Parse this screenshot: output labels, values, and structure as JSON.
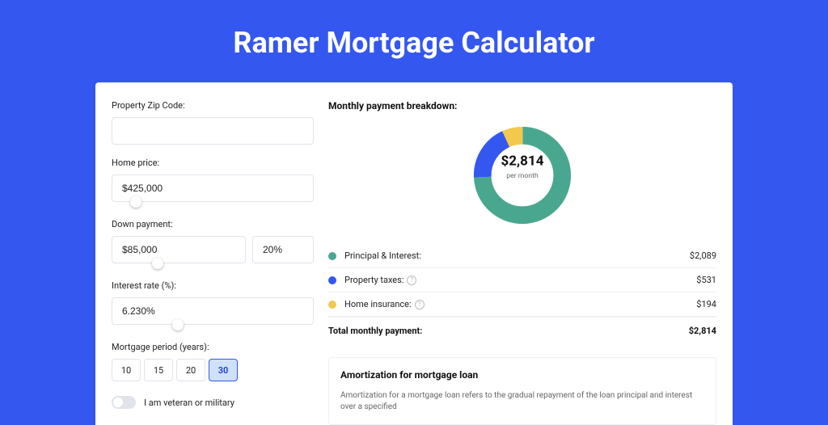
{
  "title": "Ramer Mortgage Calculator",
  "colors": {
    "green": "#4aa78f",
    "blue": "#3457f0",
    "yellow": "#f2c94c"
  },
  "form": {
    "zip": {
      "label": "Property Zip Code:",
      "value": ""
    },
    "price": {
      "label": "Home price:",
      "value": "$425,000",
      "slider_pct": 9
    },
    "down": {
      "label": "Down payment:",
      "amount": "$85,000",
      "pct": "20%",
      "slider_pct": 20
    },
    "rate": {
      "label": "Interest rate (%):",
      "value": "6.230%",
      "slider_pct": 30
    },
    "period": {
      "label": "Mortgage period (years):",
      "options": [
        "10",
        "15",
        "20",
        "30"
      ],
      "active": "30"
    },
    "veteran": {
      "label": "I am veteran or military",
      "on": false
    }
  },
  "breakdown": {
    "title": "Monthly payment breakdown:",
    "center_amount": "$2,814",
    "center_sub": "per month",
    "items": [
      {
        "label": "Principal & Interest:",
        "value": "$2,089",
        "color": "#4aa78f",
        "info": false
      },
      {
        "label": "Property taxes:",
        "value": "$531",
        "color": "#3457f0",
        "info": true
      },
      {
        "label": "Home insurance:",
        "value": "$194",
        "color": "#f2c94c",
        "info": true
      }
    ],
    "total_label": "Total monthly payment:",
    "total_value": "$2,814"
  },
  "chart_data": {
    "type": "pie",
    "title": "Monthly payment breakdown",
    "series": [
      {
        "name": "Principal & Interest",
        "value": 2089,
        "color": "#4aa78f"
      },
      {
        "name": "Property taxes",
        "value": 531,
        "color": "#3457f0"
      },
      {
        "name": "Home insurance",
        "value": 194,
        "color": "#f2c94c"
      }
    ],
    "total": 2814,
    "center_label": "$2,814 per month"
  },
  "amort": {
    "title": "Amortization for mortgage loan",
    "text": "Amortization for a mortgage loan refers to the gradual repayment of the loan principal and interest over a specified"
  }
}
